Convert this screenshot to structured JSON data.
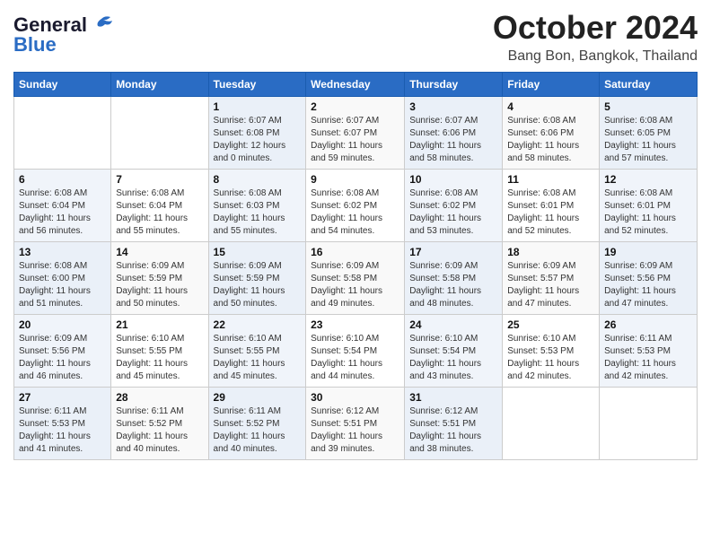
{
  "header": {
    "logo_general": "General",
    "logo_blue": "Blue",
    "month_title": "October 2024",
    "location": "Bang Bon, Bangkok, Thailand"
  },
  "days_of_week": [
    "Sunday",
    "Monday",
    "Tuesday",
    "Wednesday",
    "Thursday",
    "Friday",
    "Saturday"
  ],
  "weeks": [
    [
      {
        "day": "",
        "info": ""
      },
      {
        "day": "",
        "info": ""
      },
      {
        "day": "1",
        "info": "Sunrise: 6:07 AM\nSunset: 6:08 PM\nDaylight: 12 hours\nand 0 minutes."
      },
      {
        "day": "2",
        "info": "Sunrise: 6:07 AM\nSunset: 6:07 PM\nDaylight: 11 hours\nand 59 minutes."
      },
      {
        "day": "3",
        "info": "Sunrise: 6:07 AM\nSunset: 6:06 PM\nDaylight: 11 hours\nand 58 minutes."
      },
      {
        "day": "4",
        "info": "Sunrise: 6:08 AM\nSunset: 6:06 PM\nDaylight: 11 hours\nand 58 minutes."
      },
      {
        "day": "5",
        "info": "Sunrise: 6:08 AM\nSunset: 6:05 PM\nDaylight: 11 hours\nand 57 minutes."
      }
    ],
    [
      {
        "day": "6",
        "info": "Sunrise: 6:08 AM\nSunset: 6:04 PM\nDaylight: 11 hours\nand 56 minutes."
      },
      {
        "day": "7",
        "info": "Sunrise: 6:08 AM\nSunset: 6:04 PM\nDaylight: 11 hours\nand 55 minutes."
      },
      {
        "day": "8",
        "info": "Sunrise: 6:08 AM\nSunset: 6:03 PM\nDaylight: 11 hours\nand 55 minutes."
      },
      {
        "day": "9",
        "info": "Sunrise: 6:08 AM\nSunset: 6:02 PM\nDaylight: 11 hours\nand 54 minutes."
      },
      {
        "day": "10",
        "info": "Sunrise: 6:08 AM\nSunset: 6:02 PM\nDaylight: 11 hours\nand 53 minutes."
      },
      {
        "day": "11",
        "info": "Sunrise: 6:08 AM\nSunset: 6:01 PM\nDaylight: 11 hours\nand 52 minutes."
      },
      {
        "day": "12",
        "info": "Sunrise: 6:08 AM\nSunset: 6:01 PM\nDaylight: 11 hours\nand 52 minutes."
      }
    ],
    [
      {
        "day": "13",
        "info": "Sunrise: 6:08 AM\nSunset: 6:00 PM\nDaylight: 11 hours\nand 51 minutes."
      },
      {
        "day": "14",
        "info": "Sunrise: 6:09 AM\nSunset: 5:59 PM\nDaylight: 11 hours\nand 50 minutes."
      },
      {
        "day": "15",
        "info": "Sunrise: 6:09 AM\nSunset: 5:59 PM\nDaylight: 11 hours\nand 50 minutes."
      },
      {
        "day": "16",
        "info": "Sunrise: 6:09 AM\nSunset: 5:58 PM\nDaylight: 11 hours\nand 49 minutes."
      },
      {
        "day": "17",
        "info": "Sunrise: 6:09 AM\nSunset: 5:58 PM\nDaylight: 11 hours\nand 48 minutes."
      },
      {
        "day": "18",
        "info": "Sunrise: 6:09 AM\nSunset: 5:57 PM\nDaylight: 11 hours\nand 47 minutes."
      },
      {
        "day": "19",
        "info": "Sunrise: 6:09 AM\nSunset: 5:56 PM\nDaylight: 11 hours\nand 47 minutes."
      }
    ],
    [
      {
        "day": "20",
        "info": "Sunrise: 6:09 AM\nSunset: 5:56 PM\nDaylight: 11 hours\nand 46 minutes."
      },
      {
        "day": "21",
        "info": "Sunrise: 6:10 AM\nSunset: 5:55 PM\nDaylight: 11 hours\nand 45 minutes."
      },
      {
        "day": "22",
        "info": "Sunrise: 6:10 AM\nSunset: 5:55 PM\nDaylight: 11 hours\nand 45 minutes."
      },
      {
        "day": "23",
        "info": "Sunrise: 6:10 AM\nSunset: 5:54 PM\nDaylight: 11 hours\nand 44 minutes."
      },
      {
        "day": "24",
        "info": "Sunrise: 6:10 AM\nSunset: 5:54 PM\nDaylight: 11 hours\nand 43 minutes."
      },
      {
        "day": "25",
        "info": "Sunrise: 6:10 AM\nSunset: 5:53 PM\nDaylight: 11 hours\nand 42 minutes."
      },
      {
        "day": "26",
        "info": "Sunrise: 6:11 AM\nSunset: 5:53 PM\nDaylight: 11 hours\nand 42 minutes."
      }
    ],
    [
      {
        "day": "27",
        "info": "Sunrise: 6:11 AM\nSunset: 5:53 PM\nDaylight: 11 hours\nand 41 minutes."
      },
      {
        "day": "28",
        "info": "Sunrise: 6:11 AM\nSunset: 5:52 PM\nDaylight: 11 hours\nand 40 minutes."
      },
      {
        "day": "29",
        "info": "Sunrise: 6:11 AM\nSunset: 5:52 PM\nDaylight: 11 hours\nand 40 minutes."
      },
      {
        "day": "30",
        "info": "Sunrise: 6:12 AM\nSunset: 5:51 PM\nDaylight: 11 hours\nand 39 minutes."
      },
      {
        "day": "31",
        "info": "Sunrise: 6:12 AM\nSunset: 5:51 PM\nDaylight: 11 hours\nand 38 minutes."
      },
      {
        "day": "",
        "info": ""
      },
      {
        "day": "",
        "info": ""
      }
    ]
  ]
}
